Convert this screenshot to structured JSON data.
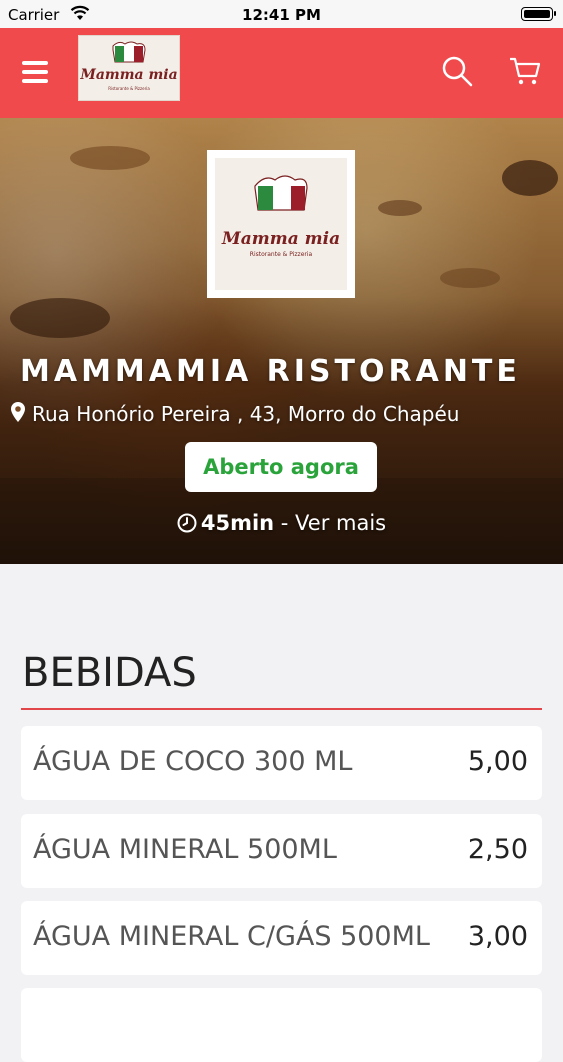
{
  "status_bar": {
    "carrier": "Carrier",
    "time": "12:41 PM"
  },
  "header": {
    "menu_icon": "hamburger-menu-icon",
    "logo_text": "Mamma mia",
    "logo_subtext": "Ristorante & Pizzeria",
    "search_icon": "search-icon",
    "cart_icon": "cart-icon",
    "color": "#f04a4d"
  },
  "restaurant": {
    "name": "MAMMAMIA RISTORANTE",
    "address": "Rua Honório Pereira , 43, Morro do Chapéu",
    "status": "Aberto agora",
    "eta": "45min",
    "more": " - Ver mais"
  },
  "menu": {
    "category": "BEBIDAS",
    "items": [
      {
        "name": "ÁGUA DE COCO 300 ML",
        "price": "5,00"
      },
      {
        "name": "ÁGUA MINERAL 500ML",
        "price": "2,50"
      },
      {
        "name": "ÁGUA MINERAL C/GÁS 500ML",
        "price": "3,00"
      }
    ]
  },
  "colors": {
    "accent": "#f04a4d",
    "open_status": "#2aa33b",
    "divider": "#e24649"
  }
}
